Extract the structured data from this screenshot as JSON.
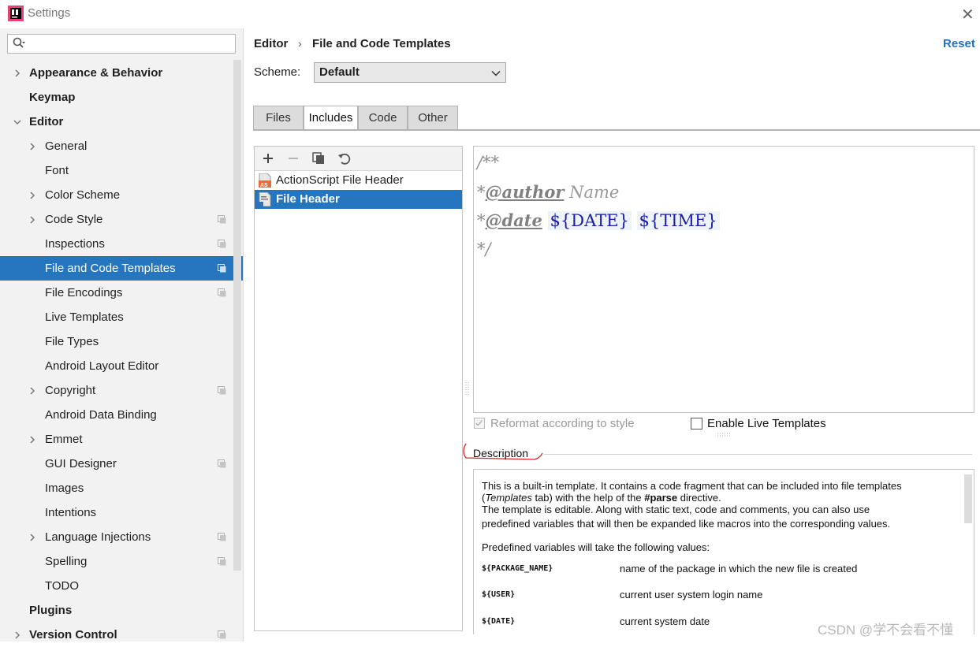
{
  "window": {
    "title": "Settings"
  },
  "search": {
    "placeholder": ""
  },
  "sidebar": {
    "items": [
      {
        "label": "Appearance & Behavior",
        "level": 0,
        "bold": true,
        "arrow": "right",
        "proj": false
      },
      {
        "label": "Keymap",
        "level": 0,
        "bold": true,
        "arrow": "",
        "proj": false
      },
      {
        "label": "Editor",
        "level": 0,
        "bold": true,
        "arrow": "down",
        "proj": false
      },
      {
        "label": "General",
        "level": 1,
        "bold": false,
        "arrow": "right",
        "proj": false
      },
      {
        "label": "Font",
        "level": 1,
        "bold": false,
        "arrow": "",
        "proj": false
      },
      {
        "label": "Color Scheme",
        "level": 1,
        "bold": false,
        "arrow": "right",
        "proj": false
      },
      {
        "label": "Code Style",
        "level": 1,
        "bold": false,
        "arrow": "right",
        "proj": true
      },
      {
        "label": "Inspections",
        "level": 1,
        "bold": false,
        "arrow": "",
        "proj": true
      },
      {
        "label": "File and Code Templates",
        "level": 1,
        "bold": false,
        "arrow": "",
        "proj": true,
        "selected": true
      },
      {
        "label": "File Encodings",
        "level": 1,
        "bold": false,
        "arrow": "",
        "proj": true
      },
      {
        "label": "Live Templates",
        "level": 1,
        "bold": false,
        "arrow": "",
        "proj": false
      },
      {
        "label": "File Types",
        "level": 1,
        "bold": false,
        "arrow": "",
        "proj": false
      },
      {
        "label": "Android Layout Editor",
        "level": 1,
        "bold": false,
        "arrow": "",
        "proj": false
      },
      {
        "label": "Copyright",
        "level": 1,
        "bold": false,
        "arrow": "right",
        "proj": true
      },
      {
        "label": "Android Data Binding",
        "level": 1,
        "bold": false,
        "arrow": "",
        "proj": false
      },
      {
        "label": "Emmet",
        "level": 1,
        "bold": false,
        "arrow": "right",
        "proj": false
      },
      {
        "label": "GUI Designer",
        "level": 1,
        "bold": false,
        "arrow": "",
        "proj": true
      },
      {
        "label": "Images",
        "level": 1,
        "bold": false,
        "arrow": "",
        "proj": false
      },
      {
        "label": "Intentions",
        "level": 1,
        "bold": false,
        "arrow": "",
        "proj": false
      },
      {
        "label": "Language Injections",
        "level": 1,
        "bold": false,
        "arrow": "right",
        "proj": true
      },
      {
        "label": "Spelling",
        "level": 1,
        "bold": false,
        "arrow": "",
        "proj": true
      },
      {
        "label": "TODO",
        "level": 1,
        "bold": false,
        "arrow": "",
        "proj": false
      },
      {
        "label": "Plugins",
        "level": 0,
        "bold": true,
        "arrow": "",
        "proj": false
      },
      {
        "label": "Version Control",
        "level": 0,
        "bold": true,
        "arrow": "right",
        "proj": true
      }
    ]
  },
  "header": {
    "breadcrumb_parent": "Editor",
    "breadcrumb_sep": "›",
    "breadcrumb_page": "File and Code Templates",
    "reset": "Reset"
  },
  "scheme": {
    "label": "Scheme:",
    "value": "Default"
  },
  "tabs": [
    {
      "label": "Files",
      "active": false
    },
    {
      "label": "Includes",
      "active": true
    },
    {
      "label": "Code",
      "active": false
    },
    {
      "label": "Other",
      "active": false
    }
  ],
  "templates": [
    {
      "label": "ActionScript File Header",
      "icon": "actionscript-file-icon",
      "selected": false
    },
    {
      "label": "File Header",
      "icon": "file-header-icon",
      "selected": true
    }
  ],
  "editor": {
    "line1": "/**",
    "line2_prefix": "*",
    "line2_tag": "@author",
    "line2_rest": " Name",
    "line3_prefix": "*",
    "line3_tag": "@date",
    "line3_var1": "${DATE}",
    "line3_var2": "${TIME}",
    "line4": "*/"
  },
  "options": {
    "reformat": "Reformat according to style",
    "live_templates": "Enable Live Templates"
  },
  "description": {
    "title": "Description",
    "p1_line1": "This is a built-in template. It contains a code fragment that can be included into file templates",
    "p1_line2a": "(",
    "p1_line2_em": "Templates",
    "p1_line2b": " tab) with the help of the ",
    "p1_line2_strong": "#parse",
    "p1_line2c": " directive.",
    "p1_line3": "The template is editable. Along with static text, code and comments, you can also use",
    "p1_line4": "predefined variables that will then be expanded like macros into the corresponding values.",
    "p2": "Predefined variables will take the following values:",
    "vars": [
      {
        "name": "${PACKAGE_NAME}",
        "desc": "name of the package in which the new file is created"
      },
      {
        "name": "${USER}",
        "desc": "current user system login name"
      },
      {
        "name": "${DATE}",
        "desc": "current system date"
      }
    ]
  },
  "watermark": "CSDN @学不会看不懂",
  "colors": {
    "accent": "#2675bf",
    "link": "#2470c2"
  }
}
